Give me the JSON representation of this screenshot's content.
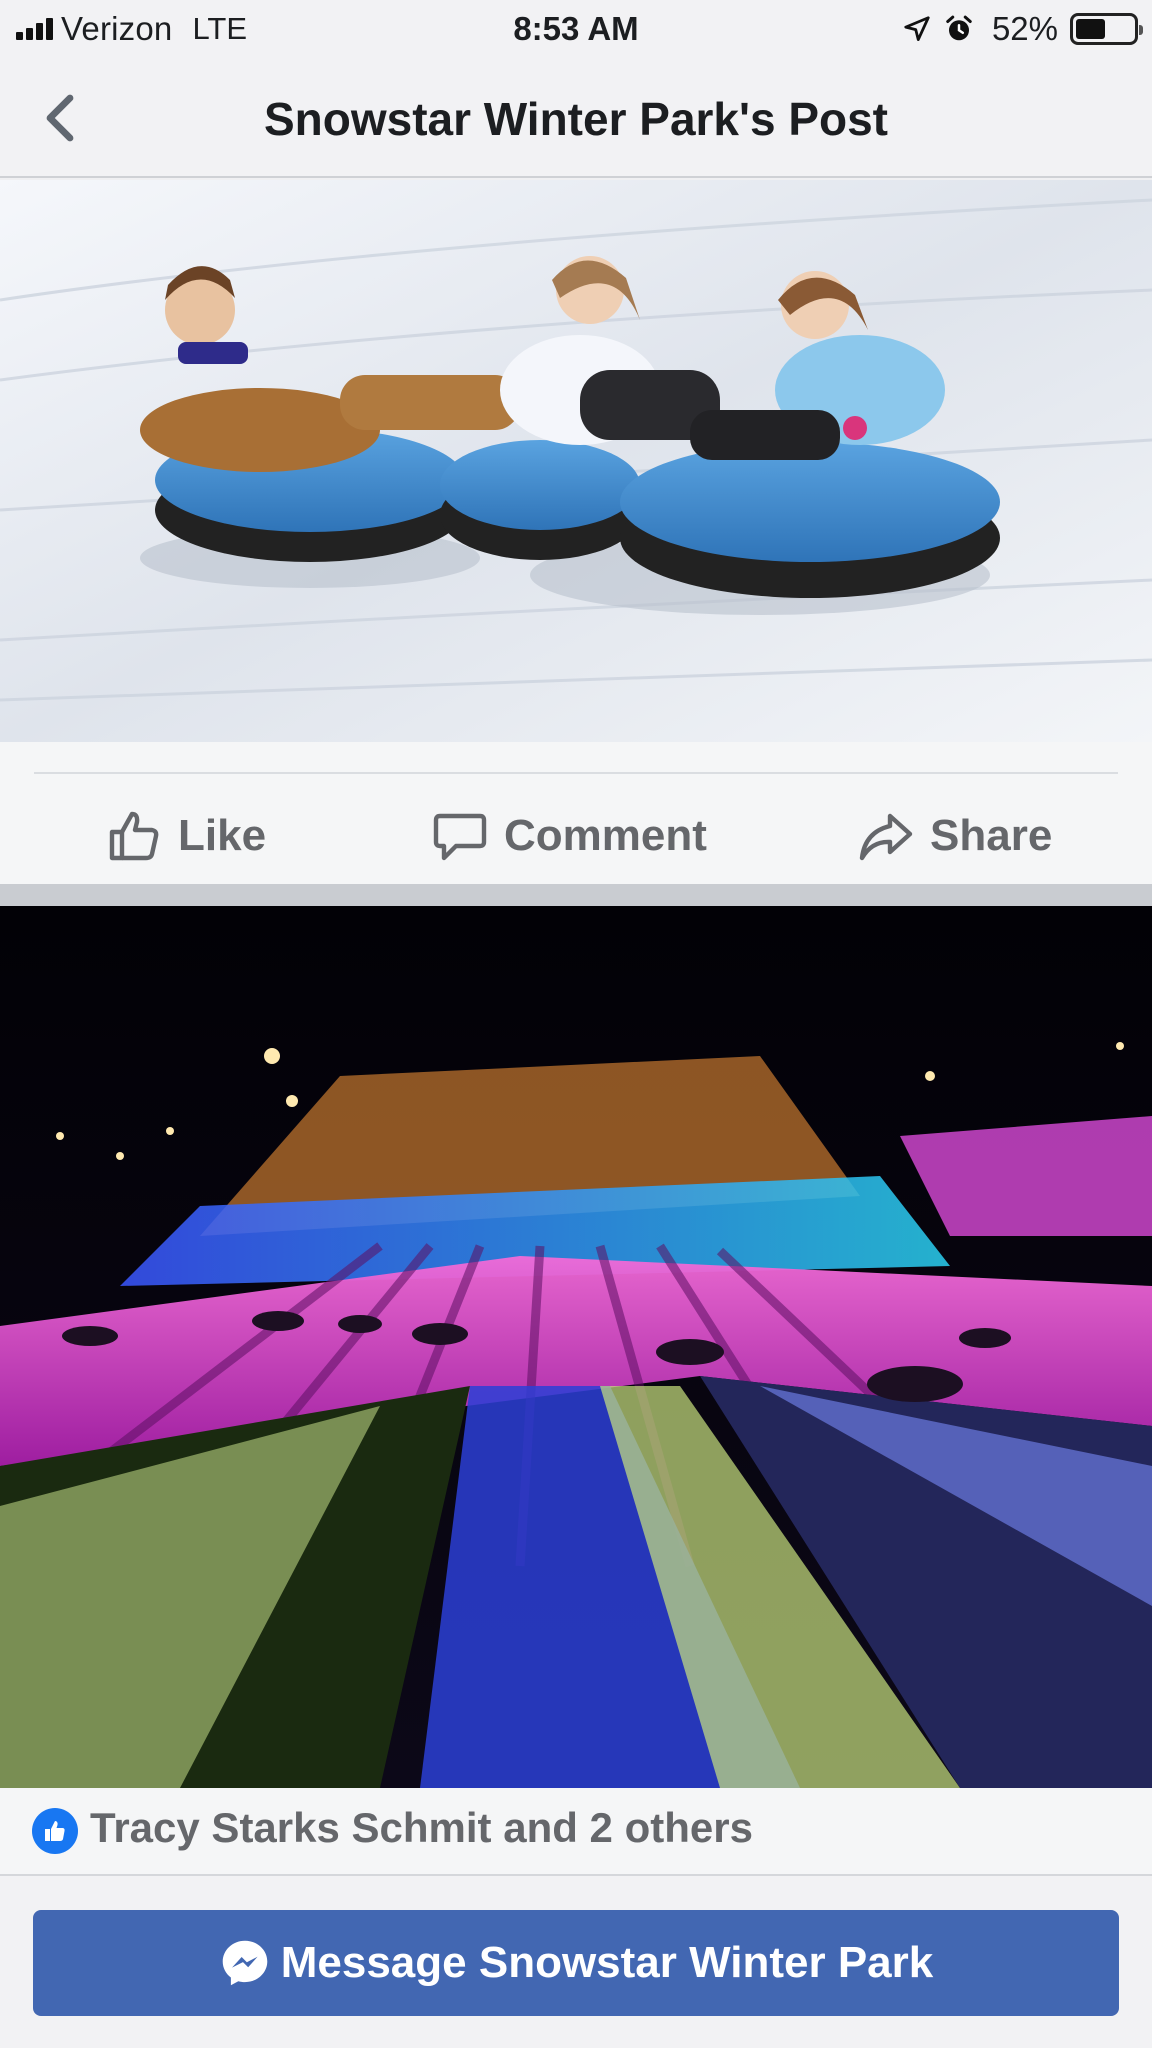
{
  "status_bar": {
    "carrier": "Verizon",
    "network": "LTE",
    "time": "8:53 AM",
    "battery_percent": "52%",
    "battery_level": 0.52,
    "icons": [
      "signal-icon",
      "location-arrow-icon",
      "alarm-clock-icon",
      "battery-icon"
    ]
  },
  "nav": {
    "title": "Snowstar Winter Park's Post",
    "back_icon": "chevron-left-icon"
  },
  "post": {
    "photos": [
      {
        "subject": "three kids snow tubing on blue tubes"
      },
      {
        "subject": "night tubing lanes lit in purple, blue and green"
      }
    ],
    "actions": {
      "like": "Like",
      "comment": "Comment",
      "share": "Share"
    },
    "reactions_text": "Tracy Starks Schmit and 2 others"
  },
  "message_button": {
    "label": "Message Snowstar Winter Park",
    "icon": "messenger-icon"
  },
  "colors": {
    "accent": "#4267b2",
    "like_blue": "#1877f2",
    "muted_text": "#65676b"
  }
}
